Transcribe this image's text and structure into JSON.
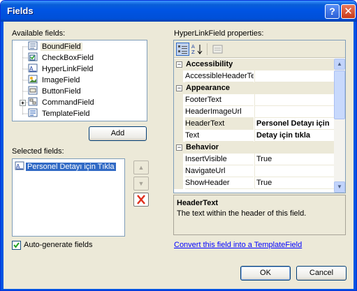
{
  "window": {
    "title": "Fields",
    "help_label": "?",
    "close_label": "✕"
  },
  "available": {
    "label": "Available fields:",
    "items": [
      {
        "label": "BoundField",
        "icon": "bound-field-icon",
        "selected": true
      },
      {
        "label": "CheckBoxField",
        "icon": "checkbox-field-icon"
      },
      {
        "label": "HyperLinkField",
        "icon": "hyperlink-field-icon"
      },
      {
        "label": "ImageField",
        "icon": "image-field-icon"
      },
      {
        "label": "ButtonField",
        "icon": "button-field-icon"
      },
      {
        "label": "CommandField",
        "icon": "command-field-icon",
        "expandable": true
      },
      {
        "label": "TemplateField",
        "icon": "template-field-icon"
      }
    ],
    "expander": "+",
    "add_label": "Add"
  },
  "selected": {
    "label": "Selected fields:",
    "items": [
      {
        "label": "Personel Detayı için Tıkla",
        "icon": "hyperlink-field-icon"
      }
    ]
  },
  "properties": {
    "label": "HyperLinkField properties:",
    "toolbar": [
      "categorized-icon",
      "alphabetical-icon",
      "property-pages-icon"
    ],
    "categories": [
      {
        "name": "Accessibility",
        "expander": "⊟",
        "rows": [
          {
            "name": "AccessibleHeaderTe",
            "value": ""
          }
        ]
      },
      {
        "name": "Appearance",
        "expander": "⊟",
        "rows": [
          {
            "name": "FooterText",
            "value": ""
          },
          {
            "name": "HeaderImageUrl",
            "value": ""
          },
          {
            "name": "HeaderText",
            "value": "Personel Detayı için",
            "bold": true,
            "selected": true
          },
          {
            "name": "Text",
            "value": "Detay için tıkla",
            "bold": true
          }
        ]
      },
      {
        "name": "Behavior",
        "expander": "⊟",
        "rows": [
          {
            "name": "InsertVisible",
            "value": "True"
          },
          {
            "name": "NavigateUrl",
            "value": ""
          },
          {
            "name": "ShowHeader",
            "value": "True"
          }
        ]
      }
    ],
    "scroll_up": "▲",
    "scroll_down": "▼"
  },
  "description": {
    "title": "HeaderText",
    "text": "The text within the header of this field."
  },
  "move": {
    "up": "▲",
    "down": "▼"
  },
  "autogen": {
    "label": "Auto-generate fields",
    "checked": true
  },
  "convert_link": "Convert this field into a TemplateField",
  "buttons": {
    "ok": "OK",
    "cancel": "Cancel"
  }
}
